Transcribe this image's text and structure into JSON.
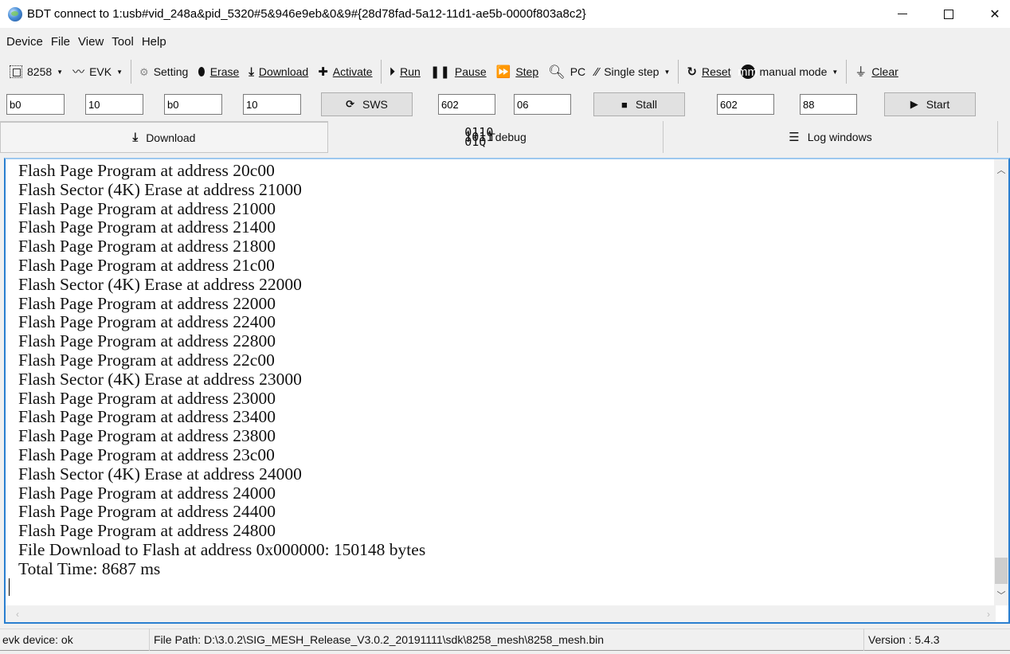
{
  "window": {
    "title": "BDT connect to 1:usb#vid_248a&pid_5320#5&946e9eb&0&9#{28d78fad-5a12-11d1-ae5b-0000f803a8c2}",
    "minimize_glyph": "",
    "maximize_glyph": "",
    "close_glyph": "✕"
  },
  "menu": {
    "items": [
      "Device",
      "File",
      "View",
      "Tool",
      "Help"
    ]
  },
  "toolbar": {
    "chip_select": {
      "label": "8258",
      "icon": "chip-icon"
    },
    "board_select": {
      "label": "EVK",
      "icon": "signal-icon"
    },
    "setting": {
      "label": "Setting",
      "icon": "gear-icon"
    },
    "erase": {
      "label": "Erase",
      "icon": "eraser-icon"
    },
    "download": {
      "label": "Download",
      "icon": "download-icon"
    },
    "activate": {
      "label": "Activate",
      "icon": "plus-icon"
    },
    "run": {
      "label": "Run",
      "icon": "run-icon"
    },
    "pause": {
      "label": "Pause",
      "icon": "pause-icon"
    },
    "step": {
      "label": "Step",
      "icon": "step-icon"
    },
    "pc": {
      "label": "PC",
      "icon": "search-icon"
    },
    "single_step": {
      "label": "Single step",
      "icon": "footsteps-icon"
    },
    "reset": {
      "label": "Reset",
      "icon": "reset-icon"
    },
    "mode": {
      "label": "manual mode",
      "icon": "mm-icon",
      "icon_text": "mm"
    },
    "clear": {
      "label": "Clear",
      "icon": "broom-icon"
    }
  },
  "inputs": {
    "field1": "b0",
    "field2": "10",
    "field3": "b0",
    "field4": "10",
    "sws_button": "SWS",
    "field5": "602",
    "field6": "06",
    "stall_button": "Stall",
    "field7": "602",
    "field8": "88",
    "start_button": "Start"
  },
  "tabs": [
    {
      "label": "Download",
      "icon": "download-icon",
      "active": true
    },
    {
      "label": "Tdebug",
      "icon": "binary-search-icon",
      "active": false
    },
    {
      "label": "Log windows",
      "icon": "list-icon",
      "active": false
    }
  ],
  "log": {
    "lines": [
      "Flash Page Program at address 20c00",
      "Flash Sector (4K) Erase at address 21000",
      "Flash Page Program at address 21000",
      "Flash Page Program at address 21400",
      "Flash Page Program at address 21800",
      "Flash Page Program at address 21c00",
      "Flash Sector (4K) Erase at address 22000",
      "Flash Page Program at address 22000",
      "Flash Page Program at address 22400",
      "Flash Page Program at address 22800",
      "Flash Page Program at address 22c00",
      "Flash Sector (4K) Erase at address 23000",
      "Flash Page Program at address 23000",
      "Flash Page Program at address 23400",
      "Flash Page Program at address 23800",
      "Flash Page Program at address 23c00",
      "Flash Sector (4K) Erase at address 24000",
      "Flash Page Program at address 24000",
      "Flash Page Program at address 24400",
      "Flash Page Program at address 24800",
      "File Download to Flash at address 0x000000: 150148 bytes",
      "Total Time: 8687 ms"
    ]
  },
  "status": {
    "device": "evk device: ok",
    "file_path": "File Path:  D:\\3.0.2\\SIG_MESH_Release_V3.0.2_20191111\\sdk\\8258_mesh\\8258_mesh.bin",
    "version": "Version : 5.4.3"
  },
  "colors": {
    "accent_border": "#2a7fd0",
    "window_bg": "#f0f0f0"
  }
}
